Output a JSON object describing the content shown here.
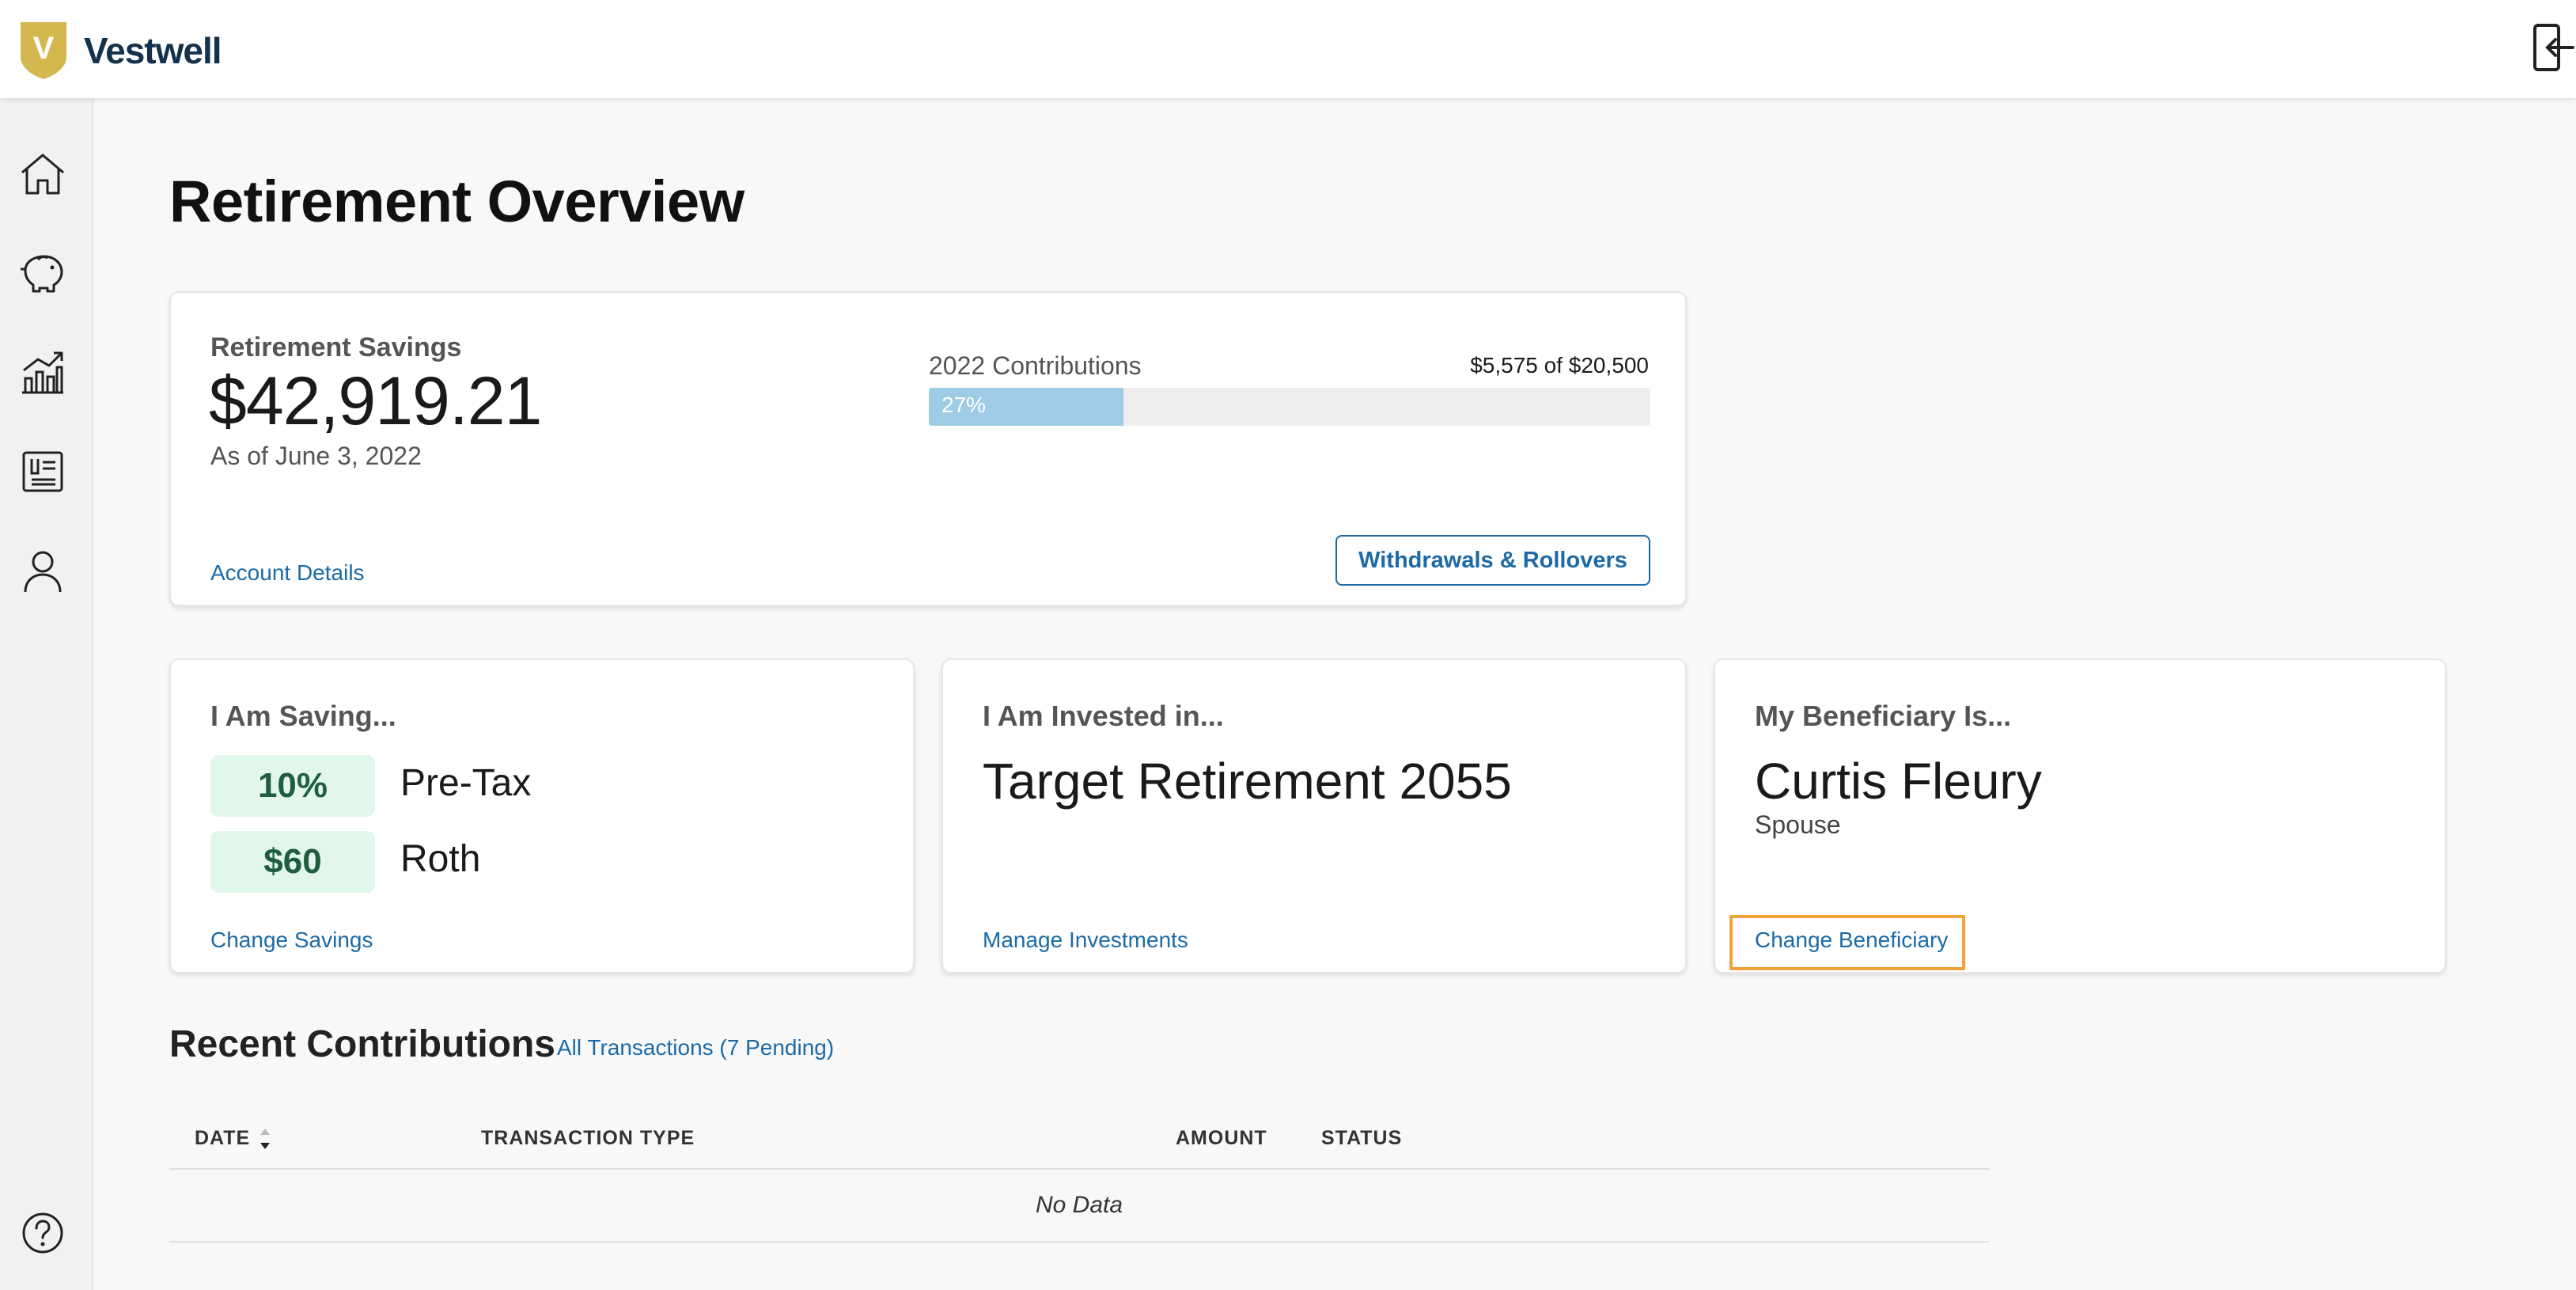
{
  "header": {
    "logo_letter": "V",
    "logo_text": "Vestwell",
    "logout_icon": "logout-icon"
  },
  "sidebar": {
    "items": [
      {
        "name": "home",
        "icon": "home-icon"
      },
      {
        "name": "savings",
        "icon": "piggy-bank-icon"
      },
      {
        "name": "investments",
        "icon": "chart-icon"
      },
      {
        "name": "documents",
        "icon": "document-icon"
      },
      {
        "name": "profile",
        "icon": "user-icon"
      },
      {
        "name": "help",
        "icon": "help-icon"
      }
    ]
  },
  "page": {
    "title": "Retirement Overview"
  },
  "savings_card": {
    "label": "Retirement Savings",
    "value": "$42,919.21",
    "as_of": "As of June 3, 2022",
    "account_link": "Account Details",
    "contributions_label": "2022 Contributions",
    "contributions_amount": "$5,575 of $20,500",
    "progress_text": "27%",
    "progress_fraction": 0.27,
    "withdraw_button": "Withdrawals & Rollovers"
  },
  "saving_card": {
    "heading": "I Am Saving...",
    "items": [
      {
        "value": "10%",
        "label": "Pre-Tax"
      },
      {
        "value": "$60",
        "label": "Roth"
      }
    ],
    "link": "Change Savings"
  },
  "invest_card": {
    "heading": "I Am Invested in...",
    "value": "Target Retirement 2055",
    "link": "Manage Investments"
  },
  "beneficiary_card": {
    "heading": "My Beneficiary Is...",
    "name": "Curtis Fleury",
    "relation": "Spouse",
    "link": "Change Beneficiary",
    "highlight_color": "#f2a23a"
  },
  "recent": {
    "title": "Recent Contributions",
    "all_link": "All Transactions (7 Pending)",
    "columns": [
      "DATE",
      "TRANSACTION TYPE",
      "AMOUNT",
      "STATUS"
    ],
    "empty": "No Data"
  },
  "colors": {
    "accent": "#1c6aa6",
    "brand_gold": "#d4b84f",
    "brand_navy": "#14324b",
    "pill_bg": "#e2f6ec",
    "progress": "#9ecbe6"
  }
}
